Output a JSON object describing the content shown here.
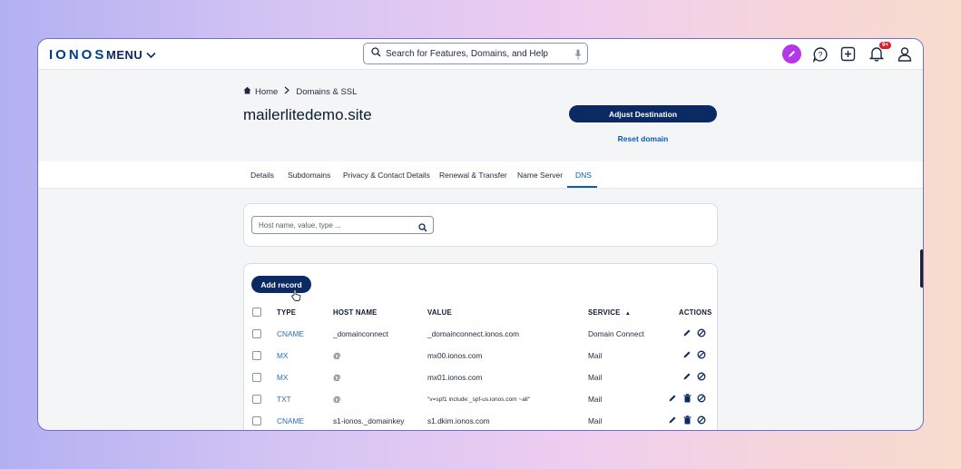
{
  "header": {
    "logo": "IONOS",
    "menu_label": "MENU",
    "search_placeholder": "Search for Features, Domains, and Help",
    "notification_badge": "9+"
  },
  "breadcrumb": {
    "home": "Home",
    "section": "Domains & SSL"
  },
  "domain": {
    "name": "mailerlitedemo.site",
    "adjust_label": "Adjust Destination",
    "reset_label": "Reset domain"
  },
  "tabs": [
    {
      "label": "Details"
    },
    {
      "label": "Subdomains"
    },
    {
      "label": "Privacy & Contact Details"
    },
    {
      "label": "Renewal & Transfer"
    },
    {
      "label": "Name Server"
    },
    {
      "label": "DNS"
    }
  ],
  "active_tab": "DNS",
  "filter": {
    "placeholder": "Host name, value, type ..."
  },
  "records": {
    "add_label": "Add record",
    "columns": {
      "type": "TYPE",
      "host": "HOST NAME",
      "value": "VALUE",
      "service": "SERVICE",
      "sort_indicator": "▲",
      "actions": "ACTIONS"
    },
    "rows": [
      {
        "type": "CNAME",
        "host": "_domainconnect",
        "value": "_domainconnect.ionos.com",
        "service": "Domain Connect"
      },
      {
        "type": "MX",
        "host": "@",
        "value": "mx00.ionos.com",
        "service": "Mail"
      },
      {
        "type": "MX",
        "host": "@",
        "value": "mx01.ionos.com",
        "service": "Mail"
      },
      {
        "type": "TXT",
        "host": "@",
        "value": "\"v=spf1 include:_spf-us.ionos.com ~all\"",
        "service": "Mail"
      },
      {
        "type": "CNAME",
        "host": "s1-ionos._domainkey",
        "value": "s1.dkim.ionos.com",
        "service": "Mail"
      }
    ]
  },
  "colors": {
    "primary": "#0b2a63",
    "link": "#0b5bb5",
    "accent_pen": "#b437e8",
    "badge": "#d7222b"
  }
}
